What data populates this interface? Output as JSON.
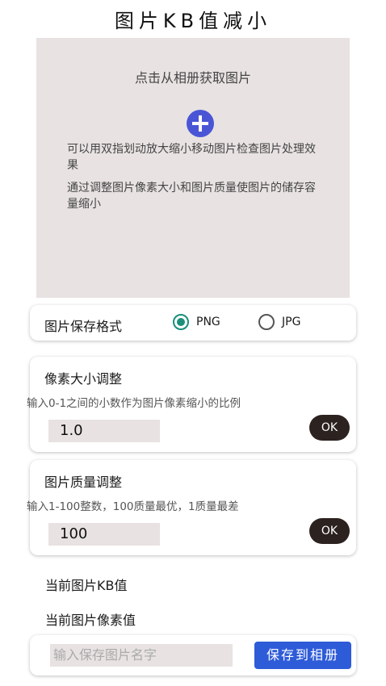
{
  "header": {
    "title": "图片KB值减小"
  },
  "preview": {
    "pick_text": "点击从相册获取图片",
    "hint1": "可以用双指划动放大缩小移动图片检查图片处理效果",
    "hint2": "通过调整图片像素大小和图片质量使图片的储存容量缩小"
  },
  "format": {
    "label": "图片保存格式",
    "options": [
      {
        "label": "PNG",
        "checked": true
      },
      {
        "label": "JPG",
        "checked": false
      }
    ]
  },
  "pixel": {
    "title": "像素大小调整",
    "desc": "输入0-1之间的小数作为图片像素缩小的比例",
    "value": "1.0",
    "ok": "OK"
  },
  "quality": {
    "title": "图片质量调整",
    "desc": "输入1-100整数，100质量最优，1质量最差",
    "value": "100",
    "ok": "OK"
  },
  "info": {
    "kb_label": "当前图片KB值",
    "pixel_label": "当前图片像素值"
  },
  "save": {
    "placeholder": "输入保存图片名字",
    "button": "保存到相册"
  },
  "colors": {
    "accent": "#1a8f7a",
    "plus_button": "#4a55d6",
    "ok_button": "#2c2220",
    "save_button": "#2e5bd8",
    "field_bg": "#e8e2e2"
  }
}
